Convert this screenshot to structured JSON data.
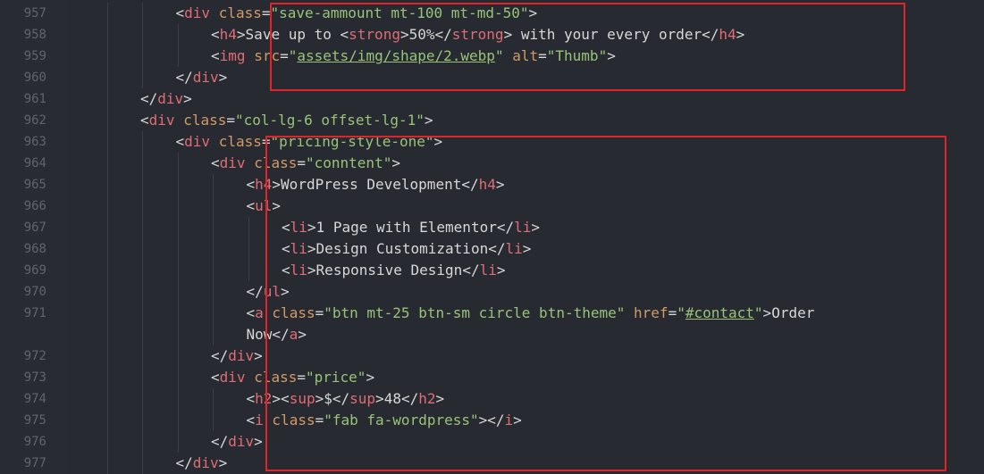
{
  "line_numbers": [
    "957",
    "958",
    "959",
    "960",
    "961",
    "962",
    "963",
    "964",
    "965",
    "966",
    "967",
    "968",
    "969",
    "970",
    "971",
    "",
    "972",
    "973",
    "974",
    "975",
    "976",
    "977"
  ],
  "lines": [
    {
      "indent": 3,
      "tokens": [
        [
          "punc",
          "<"
        ],
        [
          "tag",
          "div"
        ],
        [
          "text",
          " "
        ],
        [
          "attr",
          "class"
        ],
        [
          "punc",
          "="
        ],
        [
          "str",
          "\"save-ammount mt-100 mt-md-50\""
        ],
        [
          "punc",
          ">"
        ]
      ]
    },
    {
      "indent": 4,
      "tokens": [
        [
          "punc",
          "<"
        ],
        [
          "tag",
          "h4"
        ],
        [
          "punc",
          ">"
        ],
        [
          "text",
          "Save up to "
        ],
        [
          "punc",
          "<"
        ],
        [
          "tag",
          "strong"
        ],
        [
          "punc",
          ">"
        ],
        [
          "text",
          "50%"
        ],
        [
          "punc",
          "</"
        ],
        [
          "tag",
          "strong"
        ],
        [
          "punc",
          ">"
        ],
        [
          "text",
          " with your every order"
        ],
        [
          "punc",
          "</"
        ],
        [
          "tag",
          "h4"
        ],
        [
          "punc",
          ">"
        ]
      ]
    },
    {
      "indent": 4,
      "tokens": [
        [
          "punc",
          "<"
        ],
        [
          "tag",
          "img"
        ],
        [
          "text",
          " "
        ],
        [
          "attr",
          "src"
        ],
        [
          "punc",
          "="
        ],
        [
          "str",
          "\""
        ],
        [
          "str-u",
          "assets/img/shape/2.webp"
        ],
        [
          "str",
          "\""
        ],
        [
          "text",
          " "
        ],
        [
          "attr",
          "alt"
        ],
        [
          "punc",
          "="
        ],
        [
          "str",
          "\"Thumb\""
        ],
        [
          "punc",
          ">"
        ]
      ]
    },
    {
      "indent": 3,
      "tokens": [
        [
          "punc",
          "</"
        ],
        [
          "tag",
          "div"
        ],
        [
          "punc",
          ">"
        ]
      ]
    },
    {
      "indent": 2,
      "tokens": [
        [
          "punc",
          "</"
        ],
        [
          "tag",
          "div"
        ],
        [
          "punc",
          ">"
        ]
      ]
    },
    {
      "indent": 2,
      "tokens": [
        [
          "punc",
          "<"
        ],
        [
          "tag",
          "div"
        ],
        [
          "text",
          " "
        ],
        [
          "attr",
          "class"
        ],
        [
          "punc",
          "="
        ],
        [
          "str",
          "\"col-lg-6 offset-lg-1\""
        ],
        [
          "punc",
          ">"
        ]
      ]
    },
    {
      "indent": 3,
      "tokens": [
        [
          "punc",
          "<"
        ],
        [
          "tag",
          "div"
        ],
        [
          "text",
          " "
        ],
        [
          "attr",
          "class"
        ],
        [
          "punc",
          "="
        ],
        [
          "str",
          "\"pricing-style-one\""
        ],
        [
          "punc",
          ">"
        ]
      ]
    },
    {
      "indent": 4,
      "tokens": [
        [
          "punc",
          "<"
        ],
        [
          "tag",
          "div"
        ],
        [
          "text",
          " "
        ],
        [
          "attr",
          "class"
        ],
        [
          "punc",
          "="
        ],
        [
          "str",
          "\"conntent\""
        ],
        [
          "punc",
          ">"
        ]
      ]
    },
    {
      "indent": 5,
      "tokens": [
        [
          "punc",
          "<"
        ],
        [
          "tag",
          "h4"
        ],
        [
          "punc",
          ">"
        ],
        [
          "text",
          "WordPress Development"
        ],
        [
          "punc",
          "</"
        ],
        [
          "tag",
          "h4"
        ],
        [
          "punc",
          ">"
        ]
      ]
    },
    {
      "indent": 5,
      "tokens": [
        [
          "punc",
          "<"
        ],
        [
          "tag",
          "ul"
        ],
        [
          "punc",
          ">"
        ]
      ]
    },
    {
      "indent": 6,
      "tokens": [
        [
          "punc",
          "<"
        ],
        [
          "tag",
          "li"
        ],
        [
          "punc",
          ">"
        ],
        [
          "text",
          "1 Page with Elementor"
        ],
        [
          "punc",
          "</"
        ],
        [
          "tag",
          "li"
        ],
        [
          "punc",
          ">"
        ]
      ]
    },
    {
      "indent": 6,
      "tokens": [
        [
          "punc",
          "<"
        ],
        [
          "tag",
          "li"
        ],
        [
          "punc",
          ">"
        ],
        [
          "text",
          "Design Customization"
        ],
        [
          "punc",
          "</"
        ],
        [
          "tag",
          "li"
        ],
        [
          "punc",
          ">"
        ]
      ]
    },
    {
      "indent": 6,
      "tokens": [
        [
          "punc",
          "<"
        ],
        [
          "tag",
          "li"
        ],
        [
          "punc",
          ">"
        ],
        [
          "text",
          "Responsive Design"
        ],
        [
          "punc",
          "</"
        ],
        [
          "tag",
          "li"
        ],
        [
          "punc",
          ">"
        ]
      ]
    },
    {
      "indent": 5,
      "tokens": [
        [
          "punc",
          "</"
        ],
        [
          "tag",
          "ul"
        ],
        [
          "punc",
          ">"
        ]
      ]
    },
    {
      "indent": 5,
      "tokens": [
        [
          "punc",
          "<"
        ],
        [
          "tag",
          "a"
        ],
        [
          "text",
          " "
        ],
        [
          "attr",
          "class"
        ],
        [
          "punc",
          "="
        ],
        [
          "str",
          "\"btn mt-25 btn-sm circle btn-theme\""
        ],
        [
          "text",
          " "
        ],
        [
          "attr",
          "href"
        ],
        [
          "punc",
          "="
        ],
        [
          "str",
          "\""
        ],
        [
          "str-u",
          "#contact"
        ],
        [
          "str",
          "\""
        ],
        [
          "punc",
          ">"
        ],
        [
          "text",
          "Order"
        ]
      ]
    },
    {
      "indent": 5,
      "tokens": [
        [
          "text",
          "Now"
        ],
        [
          "punc",
          "</"
        ],
        [
          "tag",
          "a"
        ],
        [
          "punc",
          ">"
        ]
      ]
    },
    {
      "indent": 4,
      "tokens": [
        [
          "punc",
          "</"
        ],
        [
          "tag",
          "div"
        ],
        [
          "punc",
          ">"
        ]
      ]
    },
    {
      "indent": 4,
      "tokens": [
        [
          "punc",
          "<"
        ],
        [
          "tag",
          "div"
        ],
        [
          "text",
          " "
        ],
        [
          "attr",
          "class"
        ],
        [
          "punc",
          "="
        ],
        [
          "str",
          "\"price\""
        ],
        [
          "punc",
          ">"
        ]
      ]
    },
    {
      "indent": 5,
      "tokens": [
        [
          "punc",
          "<"
        ],
        [
          "tag",
          "h2"
        ],
        [
          "punc",
          ">"
        ],
        [
          "punc",
          "<"
        ],
        [
          "tag",
          "sup"
        ],
        [
          "punc",
          ">"
        ],
        [
          "text",
          "$"
        ],
        [
          "punc",
          "</"
        ],
        [
          "tag",
          "sup"
        ],
        [
          "punc",
          ">"
        ],
        [
          "text",
          "48"
        ],
        [
          "punc",
          "</"
        ],
        [
          "tag",
          "h2"
        ],
        [
          "punc",
          ">"
        ]
      ]
    },
    {
      "indent": 5,
      "tokens": [
        [
          "punc",
          "<"
        ],
        [
          "tag",
          "i"
        ],
        [
          "text",
          " "
        ],
        [
          "attr",
          "class"
        ],
        [
          "punc",
          "="
        ],
        [
          "str",
          "\"fab fa-wordpress\""
        ],
        [
          "punc",
          "></"
        ],
        [
          "tag",
          "i"
        ],
        [
          "punc",
          ">"
        ]
      ]
    },
    {
      "indent": 4,
      "tokens": [
        [
          "punc",
          "</"
        ],
        [
          "tag",
          "div"
        ],
        [
          "punc",
          ">"
        ]
      ]
    },
    {
      "indent": 3,
      "tokens": [
        [
          "punc",
          "</"
        ],
        [
          "tag",
          "div"
        ],
        [
          "punc",
          ">"
        ]
      ]
    }
  ],
  "colors": {
    "background": "#272a30",
    "tag": "#e06c75",
    "attribute": "#d19a66",
    "string": "#98c379",
    "line_number": "#5f6470",
    "highlight_box": "#e0242a"
  }
}
